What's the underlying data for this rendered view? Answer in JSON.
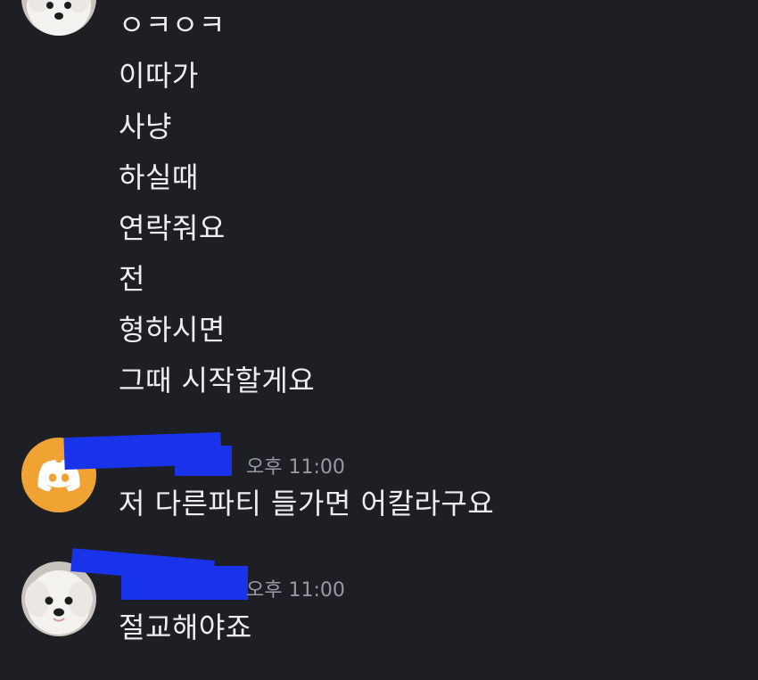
{
  "colors": {
    "background": "#1e1f24",
    "message_text": "#eceef1",
    "timestamp_text": "#959aa3",
    "discord_avatar_bg": "#f0a232",
    "redaction": "#1833e9"
  },
  "messages": {
    "group1": {
      "lines": [
        "ㅇㅋㅇㅋ",
        "이따가",
        "사냥",
        "하실때",
        "연락줘요",
        "전",
        "형하시면",
        "그때 시작할게요"
      ]
    },
    "group2": {
      "avatar_icon": "discord-logo-icon",
      "timestamp": "오후 11:00",
      "text": "저 다른파티 들가면 어칼라구요"
    },
    "group3": {
      "avatar_icon": "white-dog-avatar",
      "timestamp": "오후 11:00",
      "text": "절교해야죠"
    }
  }
}
